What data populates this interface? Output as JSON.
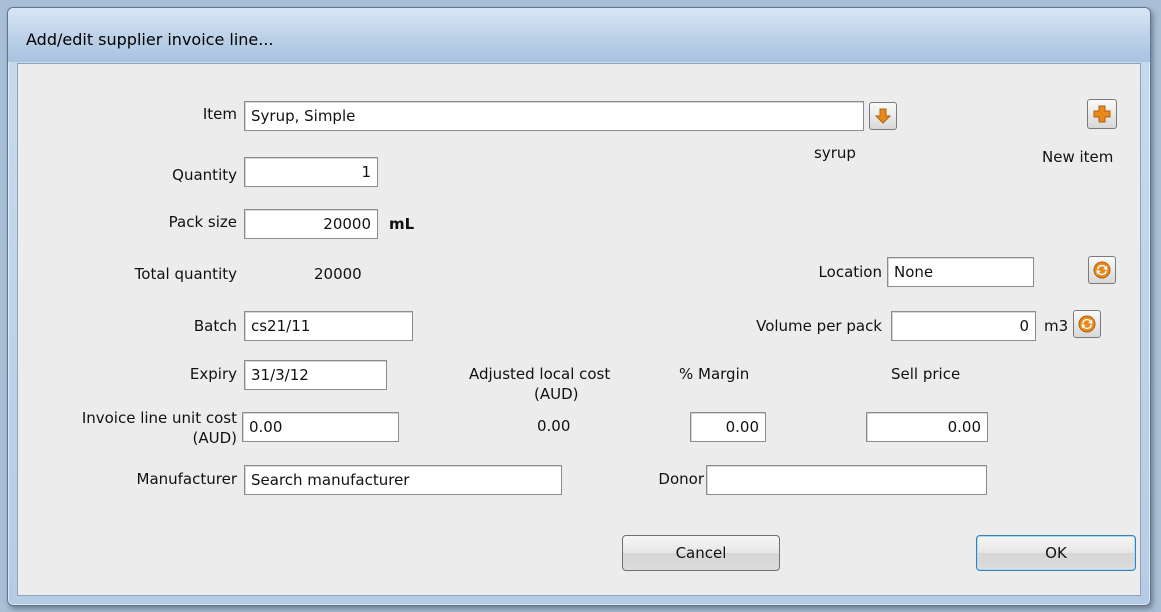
{
  "window": {
    "title": "Add/edit supplier invoice line..."
  },
  "form": {
    "item_label": "Item",
    "item_value": "Syrup, Simple",
    "item_code": "syrup",
    "new_item_label": "New item",
    "quantity_label": "Quantity",
    "quantity_value": "1",
    "pack_size_label": "Pack size",
    "pack_size_value": "20000",
    "pack_size_unit": "mL",
    "total_quantity_label": "Total quantity",
    "total_quantity_value": "20000",
    "location_label": "Location",
    "location_value": "None",
    "batch_label": "Batch",
    "batch_value": "cs21/11",
    "volume_label": "Volume per pack",
    "volume_value": "0",
    "volume_unit": "m3",
    "expiry_label": "Expiry",
    "expiry_value": "31/3/12",
    "adjusted_cost_label_1": "Adjusted local cost",
    "adjusted_cost_label_2": "(AUD)",
    "adjusted_cost_value": "0.00",
    "margin_label": "% Margin",
    "margin_value": "0.00",
    "sell_price_label": "Sell price",
    "sell_price_value": "0.00",
    "unit_cost_label_1": "Invoice line unit cost",
    "unit_cost_label_2": "(AUD)",
    "unit_cost_value": "0.00",
    "manufacturer_label": "Manufacturer",
    "manufacturer_value": "Search manufacturer",
    "donor_label": "Donor",
    "donor_value": ""
  },
  "buttons": {
    "cancel": "Cancel",
    "ok": "OK"
  },
  "icons": {
    "item_lookup": "down-arrow-icon",
    "new_item": "plus-icon",
    "location_refresh": "refresh-icon",
    "volume_refresh": "refresh-icon"
  },
  "colors": {
    "icon_orange": "#e8891c",
    "icon_orange_dark": "#b3600c"
  }
}
